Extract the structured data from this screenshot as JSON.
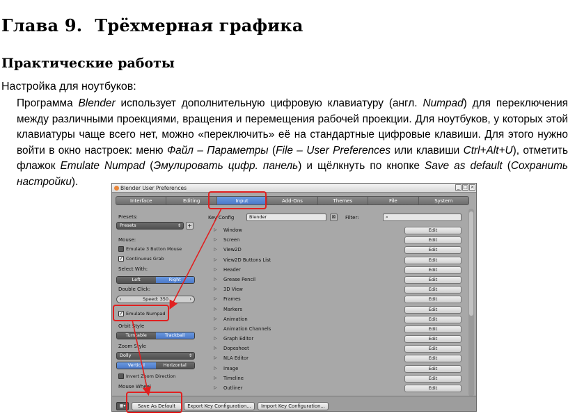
{
  "chapter": {
    "number": "Глава 9.",
    "title": "Трёхмерная графика"
  },
  "section_title": "Практические работы",
  "setup_label": "Настройка для ноутбуков:",
  "paragraph": {
    "p1": "Программа ",
    "blender": "Blender",
    "p2": " использует дополнительную цифровую клавиатуру (англ. ",
    "numpad": "Numpad",
    "p3": ") для переключения между различными проекциями, вращения и перемещения рабочей проекции. Для ноутбуков, у которых этой клавиатуры чаще всего нет, можно «переключить» её на стандартные цифровые клавиши. Для этого нужно войти в окно настроек: меню ",
    "menu_ru": "Файл – Параметры",
    "p4": " (",
    "menu_en": "File – User Preferences",
    "p5": " или клавиши ",
    "keys": "Ctrl+Alt+U",
    "p6": "), отметить флажок ",
    "flag_en": "Emulate Numpad",
    "p7": " (",
    "flag_ru": "Эмулировать цифр. панель",
    "p8": ") и щёлкнуть по кнопке ",
    "save_en": "Save as default",
    "p9": " (",
    "save_ru": "Сохранить настройки",
    "p10": ")."
  },
  "blender": {
    "title": "Blender User Preferences",
    "window_buttons": [
      "_",
      "□",
      "×"
    ],
    "tabs": [
      {
        "label": "Interface",
        "active": false
      },
      {
        "label": "Editing",
        "active": false
      },
      {
        "label": "Input",
        "active": true
      },
      {
        "label": "Add-Ons",
        "active": false
      },
      {
        "label": "Themes",
        "active": false
      },
      {
        "label": "File",
        "active": false
      },
      {
        "label": "System",
        "active": false
      }
    ],
    "presets_label": "Presets:",
    "presets_value": "Presets",
    "mouse_label": "Mouse:",
    "emulate3": "Emulate 3 Button Mouse",
    "continuous_grab": "Continuous Grab",
    "select_with_label": "Select With:",
    "select_left": "Left",
    "select_right": "Right",
    "double_click_label": "Double Click:",
    "double_click_value": "Speed: 350",
    "emulate_numpad": "Emulate Numpad",
    "orbit_style_label": "Orbit Style",
    "orbit_turntable": "Turntable",
    "orbit_trackball": "Trackball",
    "zoom_style_label": "Zoom Style",
    "zoom_value": "Dolly",
    "zoom_vertical": "Vertical",
    "zoom_horizontal": "Horizontal",
    "invert_zoom": "Invert Zoom Direction",
    "mouse_wheel_label": "Mouse Wheel",
    "key_config_label": "Key Config",
    "key_config_value": "Blender",
    "filter_label": "Filter:",
    "keymaps": [
      "Window",
      "Screen",
      "View2D",
      "View2D Buttons List",
      "Header",
      "Grease Pencil",
      "3D View",
      "Frames",
      "Markers",
      "Animation",
      "Animation Channels",
      "Graph Editor",
      "Dopesheet",
      "NLA Editor",
      "Image",
      "Timeline",
      "Outliner"
    ],
    "edit_label": "Edit",
    "bottom": {
      "save_default": "Save As Default",
      "export": "Export Key Configuration...",
      "import": "Import Key Configuration..."
    },
    "highlight_color": "#e02020",
    "accent_color": "#5a88d8"
  }
}
